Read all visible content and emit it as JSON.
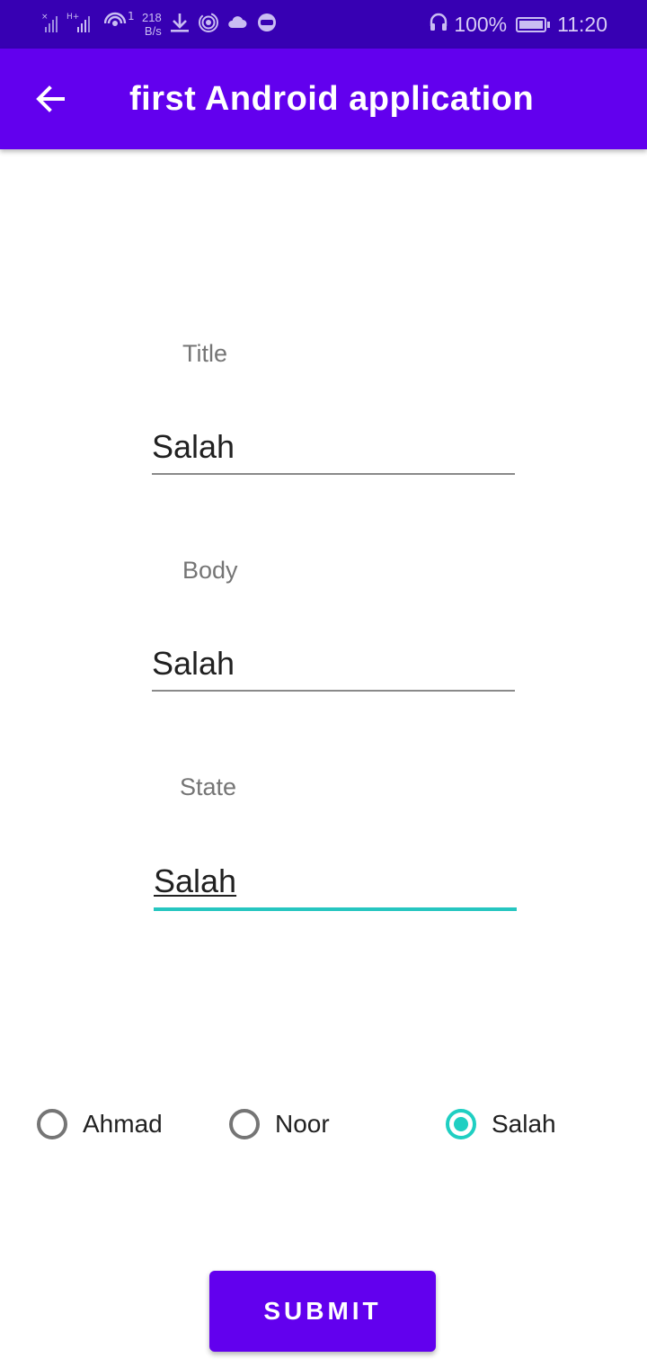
{
  "status_bar": {
    "net_speed_value": "218",
    "net_speed_unit": "B/s",
    "sim_indicator": "1",
    "battery_text": "100%",
    "battery_level": 1.0,
    "time": "11:20",
    "icons": [
      "signal-icon",
      "wifi-icon",
      "download-icon",
      "hotspot-icon",
      "cloud-icon",
      "app-notification-icon",
      "headset-icon",
      "battery-icon"
    ]
  },
  "app_bar": {
    "title": "first Android application",
    "back_icon": "arrow-back-icon"
  },
  "form": {
    "title_label": "Title",
    "title_value": "Salah",
    "body_label": "Body",
    "body_value": "Salah",
    "state_label": "State",
    "state_value": "Salah"
  },
  "radio_group": {
    "options": [
      {
        "label": "Ahmad",
        "checked": false
      },
      {
        "label": "Noor",
        "checked": false
      },
      {
        "label": "Salah",
        "checked": true
      }
    ]
  },
  "submit_label": "SUBMIT",
  "colors": {
    "status_bar": "#3700B3",
    "primary": "#6200EE",
    "accent": "#1FCFC2"
  }
}
